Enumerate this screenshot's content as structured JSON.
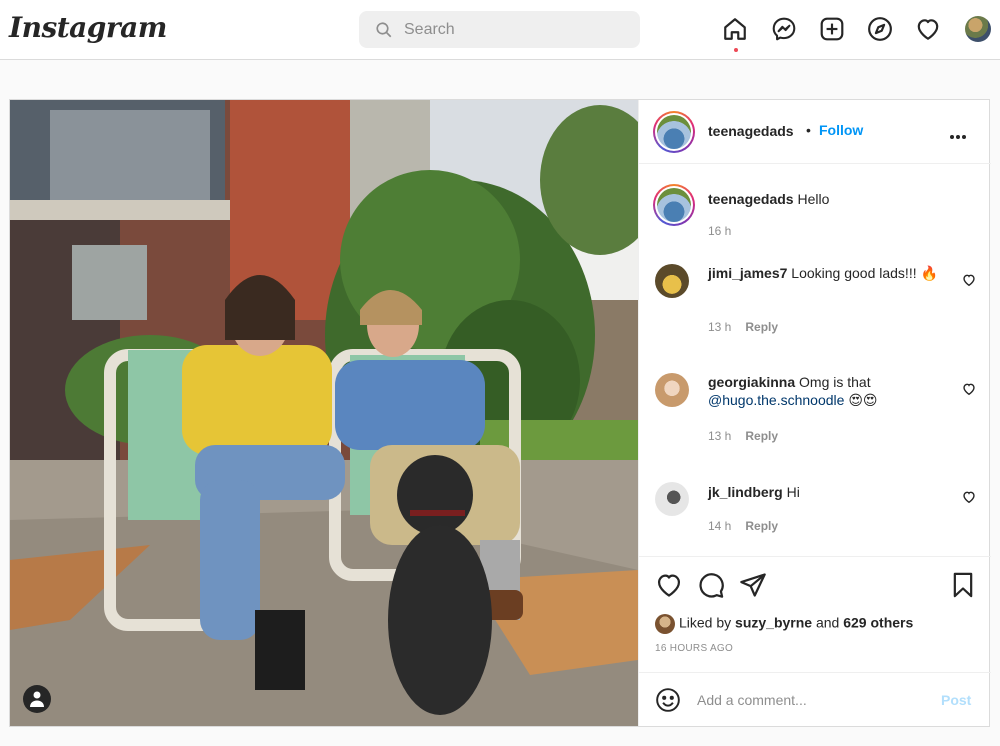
{
  "nav": {
    "logo": "Instagram",
    "search_placeholder": "Search",
    "icons": [
      "home-icon",
      "messenger-icon",
      "new-post-icon",
      "explore-icon",
      "activity-heart-icon",
      "profile-avatar"
    ]
  },
  "post": {
    "author": "teenagedads",
    "follow_label": "Follow",
    "separator": "•",
    "caption": {
      "username": "teenagedads",
      "text": "Hello",
      "time": "16 h"
    },
    "comments": [
      {
        "username": "jimi_james7",
        "text": "Looking good lads!!! 🔥",
        "time": "13 h",
        "reply": "Reply"
      },
      {
        "username": "georgiakinna",
        "text_before": "Omg is that",
        "mention": "@hugo.the.schnoodle",
        "text_after": "😍😍",
        "time": "13 h",
        "reply": "Reply"
      },
      {
        "username": "jk_lindberg",
        "text": "Hi",
        "time": "14 h",
        "reply": "Reply"
      }
    ],
    "likes": {
      "prefix": "Liked by",
      "user": "suzy_byrne",
      "joiner": "and",
      "others": "629 others"
    },
    "timestamp": "16 HOURS AGO",
    "add_comment_placeholder": "Add a comment...",
    "post_label": "Post"
  },
  "colors": {
    "accent": "#0095f6",
    "mention": "#00376b",
    "notification_dot": "#ed4956",
    "post_disabled": "#b2dffc",
    "muted": "#8e8e8e"
  }
}
